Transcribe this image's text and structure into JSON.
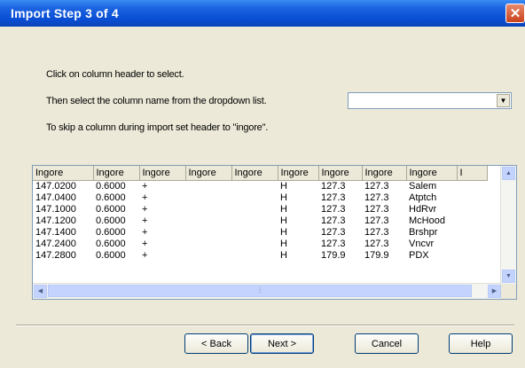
{
  "window": {
    "title": "Import Step 3 of 4",
    "close_icon": "close-icon",
    "close_glyph": "✕"
  },
  "instructions": {
    "line1": "Click on column header to select.",
    "line2": "Then select the column name from the dropdown list.",
    "line3": "To skip a column during import set header to \"ingore\"."
  },
  "column_dropdown": {
    "value": "",
    "arrow_glyph": "▼"
  },
  "grid": {
    "headers": [
      "Ingore",
      "Ingore",
      "Ingore",
      "Ingore",
      "Ingore",
      "Ingore",
      "Ingore",
      "Ingore",
      "Ingore",
      "I"
    ],
    "rows": [
      [
        "147.0200",
        "0.6000",
        "+",
        "",
        "",
        "H",
        "127.3",
        "127.3",
        "Salem",
        ""
      ],
      [
        "147.0400",
        "0.6000",
        "+",
        "",
        "",
        "H",
        "127.3",
        "127.3",
        "Atptch",
        ""
      ],
      [
        "147.1000",
        "0.6000",
        "+",
        "",
        "",
        "H",
        "127.3",
        "127.3",
        "HdRvr",
        ""
      ],
      [
        "147.1200",
        "0.6000",
        "+",
        "",
        "",
        "H",
        "127.3",
        "127.3",
        "McHood",
        ""
      ],
      [
        "147.1400",
        "0.6000",
        "+",
        "",
        "",
        "H",
        "127.3",
        "127.3",
        "Brshpr",
        ""
      ],
      [
        "147.2400",
        "0.6000",
        "+",
        "",
        "",
        "H",
        "127.3",
        "127.3",
        "Vncvr",
        ""
      ],
      [
        "147.2800",
        "0.6000",
        "+",
        "",
        "",
        "H",
        "179.9",
        "179.9",
        "PDX",
        ""
      ]
    ],
    "scroll_up_glyph": "▲",
    "scroll_down_glyph": "▼",
    "scroll_left_glyph": "◀",
    "scroll_right_glyph": "▶",
    "thumb_grip_glyph": "⦙"
  },
  "buttons": {
    "back": "< Back",
    "next": "Next >",
    "cancel": "Cancel",
    "help": "Help"
  }
}
